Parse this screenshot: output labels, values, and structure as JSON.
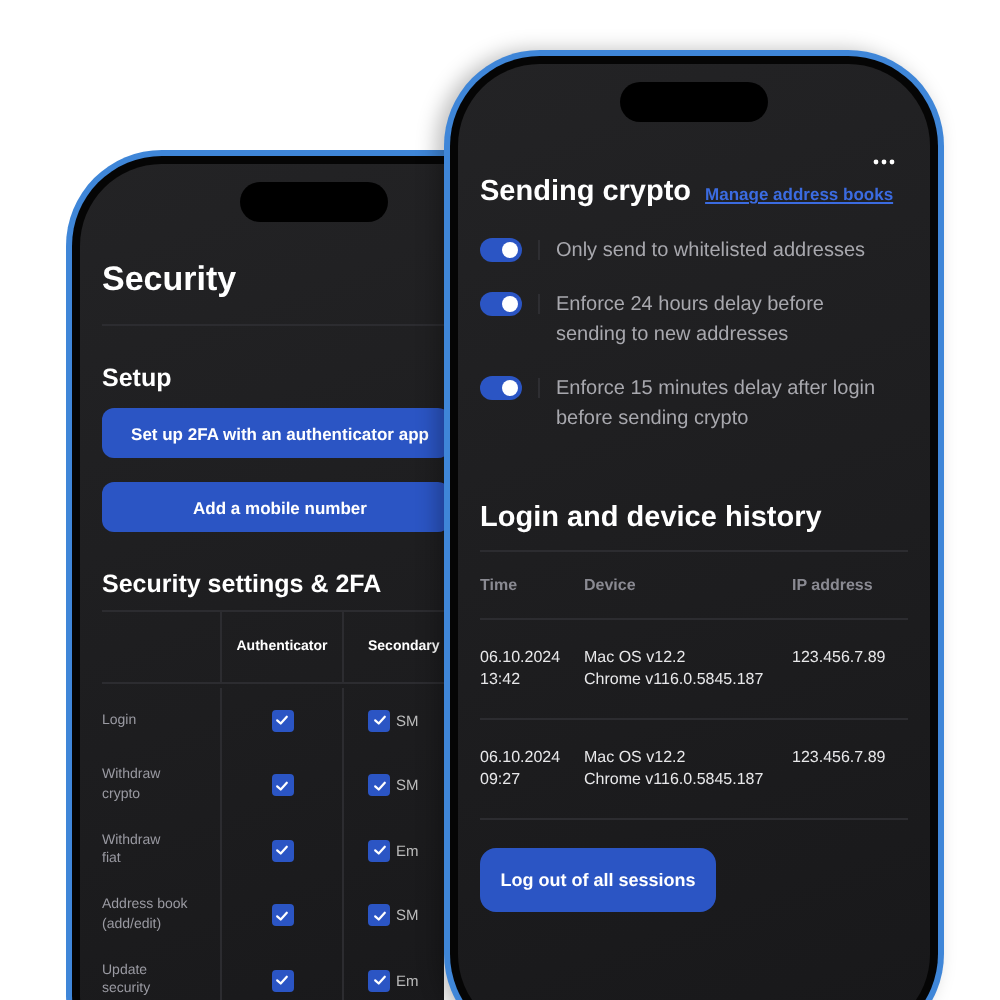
{
  "back_screen": {
    "title": "Security",
    "setup": {
      "heading": "Setup",
      "buttons": [
        "Set up 2FA with an authenticator app",
        "Add a mobile number"
      ]
    },
    "settings": {
      "heading": "Security settings & 2FA",
      "columns": [
        "Authenticator",
        "Secondary"
      ],
      "rows": [
        {
          "label": "Login",
          "authenticator": true,
          "secondary_checked": true,
          "secondary": "SM"
        },
        {
          "label": "Withdraw\ncrypto",
          "authenticator": true,
          "secondary_checked": true,
          "secondary": "SM"
        },
        {
          "label": "Withdraw\nfiat",
          "authenticator": true,
          "secondary_checked": true,
          "secondary": "Em"
        },
        {
          "label": "Address book\n(add/edit)",
          "authenticator": true,
          "secondary_checked": true,
          "secondary": "SM"
        },
        {
          "label": "Update\nsecurity",
          "authenticator": true,
          "secondary_checked": true,
          "secondary": "Em"
        }
      ]
    }
  },
  "front_screen": {
    "sending": {
      "heading": "Sending crypto",
      "link": "Manage address books",
      "toggles": [
        {
          "label": "Only send to whitelisted addresses",
          "on": true
        },
        {
          "label": "Enforce 24 hours delay before sending to new addresses",
          "on": true
        },
        {
          "label": "Enforce 15 minutes delay after login before sending crypto",
          "on": true
        }
      ]
    },
    "history": {
      "heading": "Login and device history",
      "columns": [
        "Time",
        "Device",
        "IP address"
      ],
      "rows": [
        {
          "time": "06.10.2024\n13:42",
          "device": "Mac OS v12.2\nChrome v116.0.5845.187",
          "ip": "123.456.7.89"
        },
        {
          "time": "06.10.2024\n09:27",
          "device": "Mac OS v12.2\nChrome v116.0.5845.187",
          "ip": "123.456.7.89"
        }
      ]
    },
    "logout_button": "Log out of all sessions"
  }
}
